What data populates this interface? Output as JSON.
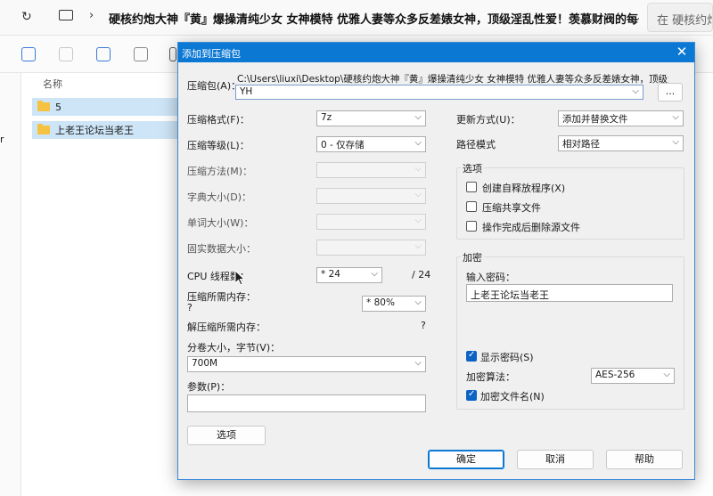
{
  "explorer": {
    "address_path": "硬核约炮大神『黄』爆操清纯少女 女神模特 优雅人妻等众多反差婊女神，顶级淫乱性爱！羡慕财阀的每一次",
    "search_placeholder": "在 硬核约炮大神",
    "column_name": "名称",
    "files": [
      {
        "name": "5",
        "selected": true
      },
      {
        "name": "上老王论坛当老王",
        "selected": true
      }
    ],
    "left_letter": "r"
  },
  "dialog": {
    "title": "添加到压缩包",
    "archive_label": "压缩包(A)：",
    "archive_path": "C:\\Users\\liuxi\\Desktop\\硬核约炮大神『黄』爆操清纯少女 女神模特 优雅人妻等众多反差婊女神，顶级淫乱性",
    "archive_name": "YH",
    "browse_label": "...",
    "format_label": "压缩格式(F)：",
    "format_value": "7z",
    "level_label": "压缩等级(L)：",
    "level_value": "0 - 仅存储",
    "method_label": "压缩方法(M)：",
    "dict_label": "字典大小(D)：",
    "word_label": "单词大小(W)：",
    "solid_label": "固实数据大小：",
    "cpu_label": "CPU 线程数：",
    "cpu_value": "* 24",
    "cpu_total": "/ 24",
    "mem_comp_label": "压缩所需内存：",
    "mem_comp_value": "?",
    "mem_comp_pct": "* 80%",
    "mem_decomp_label": "解压缩所需内存：",
    "mem_decomp_value": "?",
    "split_label": "分卷大小，字节(V)：",
    "split_value": "700M",
    "params_label": "参数(P)：",
    "params_value": "",
    "options_button": "选项",
    "update_label": "更新方式(U)：",
    "update_value": "添加并替换文件",
    "path_label": "路径模式",
    "path_value": "相对路径",
    "options_group": "选项",
    "opt_sfx": "创建自释放程序(X)",
    "opt_shared": "压缩共享文件",
    "opt_delete": "操作完成后删除源文件",
    "encrypt_group": "加密",
    "password_label": "输入密码：",
    "password_value": "上老王论坛当老王",
    "show_password": "显示密码(S)",
    "enc_method_label": "加密算法：",
    "enc_method_value": "AES-256",
    "enc_names": "加密文件名(N)",
    "ok_button": "确定",
    "cancel_button": "取消",
    "help_button": "帮助"
  },
  "colors": {
    "accent": "#0b78d4",
    "selection": "#cde5f7"
  }
}
